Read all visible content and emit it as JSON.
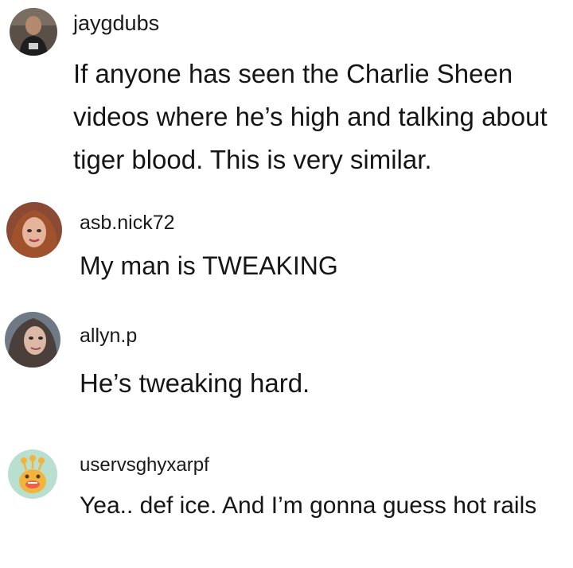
{
  "comments": [
    {
      "username": "jaygdubs",
      "text": "If anyone has seen the Charlie Sheen videos where he’s high and talking about tiger blood. This is very similar.",
      "avatar_icon": "user-photo-icon"
    },
    {
      "username": "asb.nick72",
      "text": "My man is TWEAKING",
      "avatar_icon": "user-photo-icon"
    },
    {
      "username": "allyn.p",
      "text": "He’s tweaking hard.",
      "avatar_icon": "user-photo-icon"
    },
    {
      "username": "uservsghyxarpf",
      "text": "Yea.. def ice. And I’m gonna guess hot rails",
      "avatar_icon": "monster-avatar-icon",
      "avatar_color": "#b9e0cf"
    }
  ]
}
